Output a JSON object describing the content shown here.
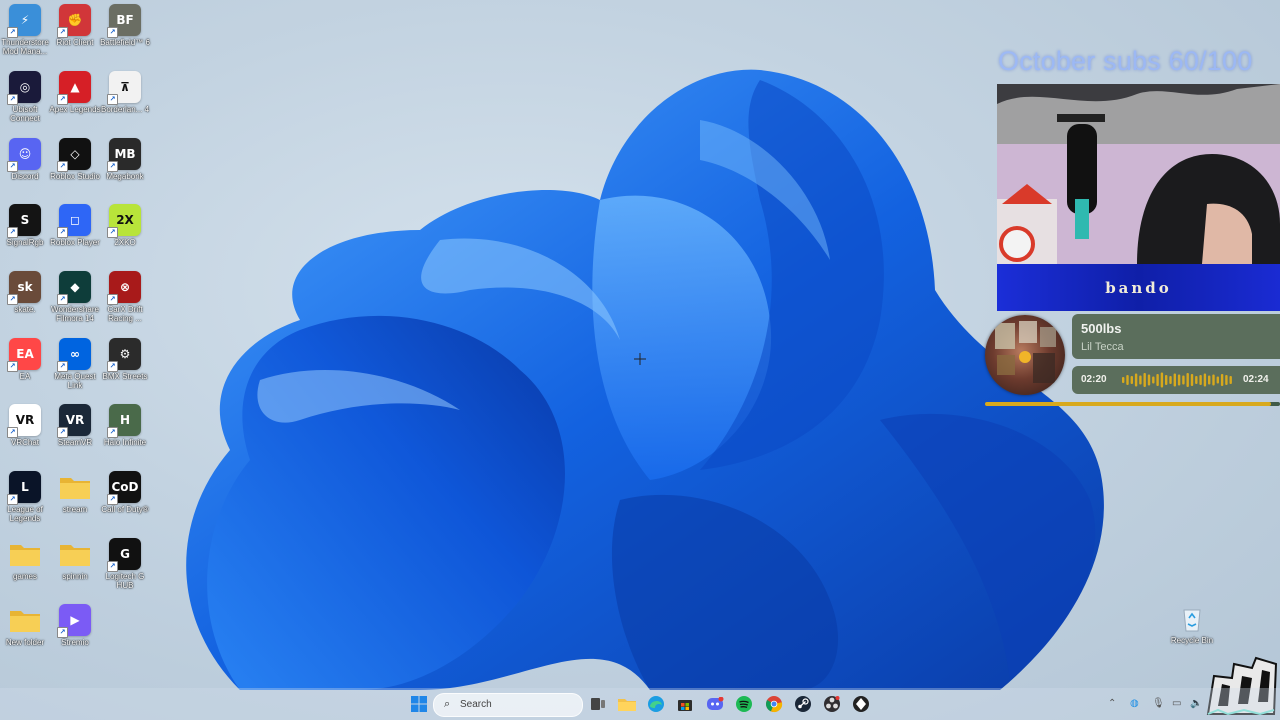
{
  "desktop": {
    "icons": [
      {
        "label": "Thunderstore Mod Mana...",
        "icon": "thunderstore-icon",
        "color": "#3a8fd9"
      },
      {
        "label": "Riot Client",
        "icon": "riot-client-icon",
        "color": "#d13639"
      },
      {
        "label": "Battlefield™ 6",
        "icon": "battlefield-icon",
        "color": "#6b6e63"
      },
      {
        "label": "Ubisoft Connect",
        "icon": "ubisoft-icon",
        "color": "#1a1a3a"
      },
      {
        "label": "Apex Legends",
        "icon": "apex-legends-icon",
        "color": "#d61f26"
      },
      {
        "label": "Borderlan... 4",
        "icon": "borderlands-icon",
        "color": "#f2f2f2"
      },
      {
        "label": "Discord",
        "icon": "discord-icon",
        "color": "#5865f2"
      },
      {
        "label": "Roblox Studio",
        "icon": "roblox-studio-icon",
        "color": "#111111"
      },
      {
        "label": "Megabonk",
        "icon": "megabonk-icon",
        "color": "#2a2a2a"
      },
      {
        "label": "SignalRgb",
        "icon": "signalrgb-icon",
        "color": "#141414"
      },
      {
        "label": "Roblox Player",
        "icon": "roblox-player-icon",
        "color": "#2e66f6"
      },
      {
        "label": "2XKO",
        "icon": "2xko-icon",
        "color": "#b8e43a"
      },
      {
        "label": "skate.",
        "icon": "skate-icon",
        "color": "#6a4b3a"
      },
      {
        "label": "Wondershare Filmora 14",
        "icon": "filmora-icon",
        "color": "#0e3d3a"
      },
      {
        "label": "CarX Drift Racing ...",
        "icon": "carx-icon",
        "color": "#a81a1a"
      },
      {
        "label": "EA",
        "icon": "ea-icon",
        "color": "#ff4747"
      },
      {
        "label": "Meta Quest Link",
        "icon": "meta-quest-icon",
        "color": "#0064e0"
      },
      {
        "label": "BMX Streets",
        "icon": "bmx-streets-icon",
        "color": "#2b2b2b"
      },
      {
        "label": "VRChat",
        "icon": "vrchat-icon",
        "color": "#ffffff"
      },
      {
        "label": "SteamVR",
        "icon": "steamvr-icon",
        "color": "#1b2838"
      },
      {
        "label": "Halo Infinite",
        "icon": "halo-infinite-icon",
        "color": "#4a6a4a"
      },
      {
        "label": "League of Legends",
        "icon": "league-of-legends-icon",
        "color": "#0a1428"
      },
      {
        "label": "stream",
        "icon": "folder-icon",
        "color": "#f5c842"
      },
      {
        "label": "Call of Duty®",
        "icon": "call-of-duty-icon",
        "color": "#111111"
      },
      {
        "label": "games",
        "icon": "folder-icon",
        "color": "#f5c842"
      },
      {
        "label": "spinnin",
        "icon": "folder-icon",
        "color": "#f5c842"
      },
      {
        "label": "Logitech G HUB",
        "icon": "logitech-ghub-icon",
        "color": "#111111"
      },
      {
        "label": "New folder",
        "icon": "folder-icon",
        "color": "#f5c842"
      },
      {
        "label": "Stremio",
        "icon": "stremio-icon",
        "color": "#7b5bf5"
      }
    ],
    "recycle_bin": {
      "label": "Recycle Bin",
      "icon": "recycle-bin-icon"
    }
  },
  "overlay": {
    "subs_goal": "October subs 60/100",
    "banner_text": "bando",
    "now_playing": {
      "title": "500lbs",
      "artist": "Lil Tecca",
      "elapsed": "02:20",
      "total": "02:24",
      "progress": 0.97,
      "card_color": "#5b6e5c",
      "progress_color": "#d8a91d"
    }
  },
  "taskbar": {
    "search_placeholder": "Search",
    "apps": [
      {
        "icon": "windows-start-icon"
      },
      {
        "icon": "task-view-icon"
      },
      {
        "icon": "file-explorer-icon"
      },
      {
        "icon": "edge-icon"
      },
      {
        "icon": "microsoft-store-icon"
      },
      {
        "icon": "discord-icon"
      },
      {
        "icon": "spotify-icon"
      },
      {
        "icon": "chrome-icon"
      },
      {
        "icon": "steam-icon"
      },
      {
        "icon": "obs-icon"
      },
      {
        "icon": "app-icon"
      }
    ]
  }
}
